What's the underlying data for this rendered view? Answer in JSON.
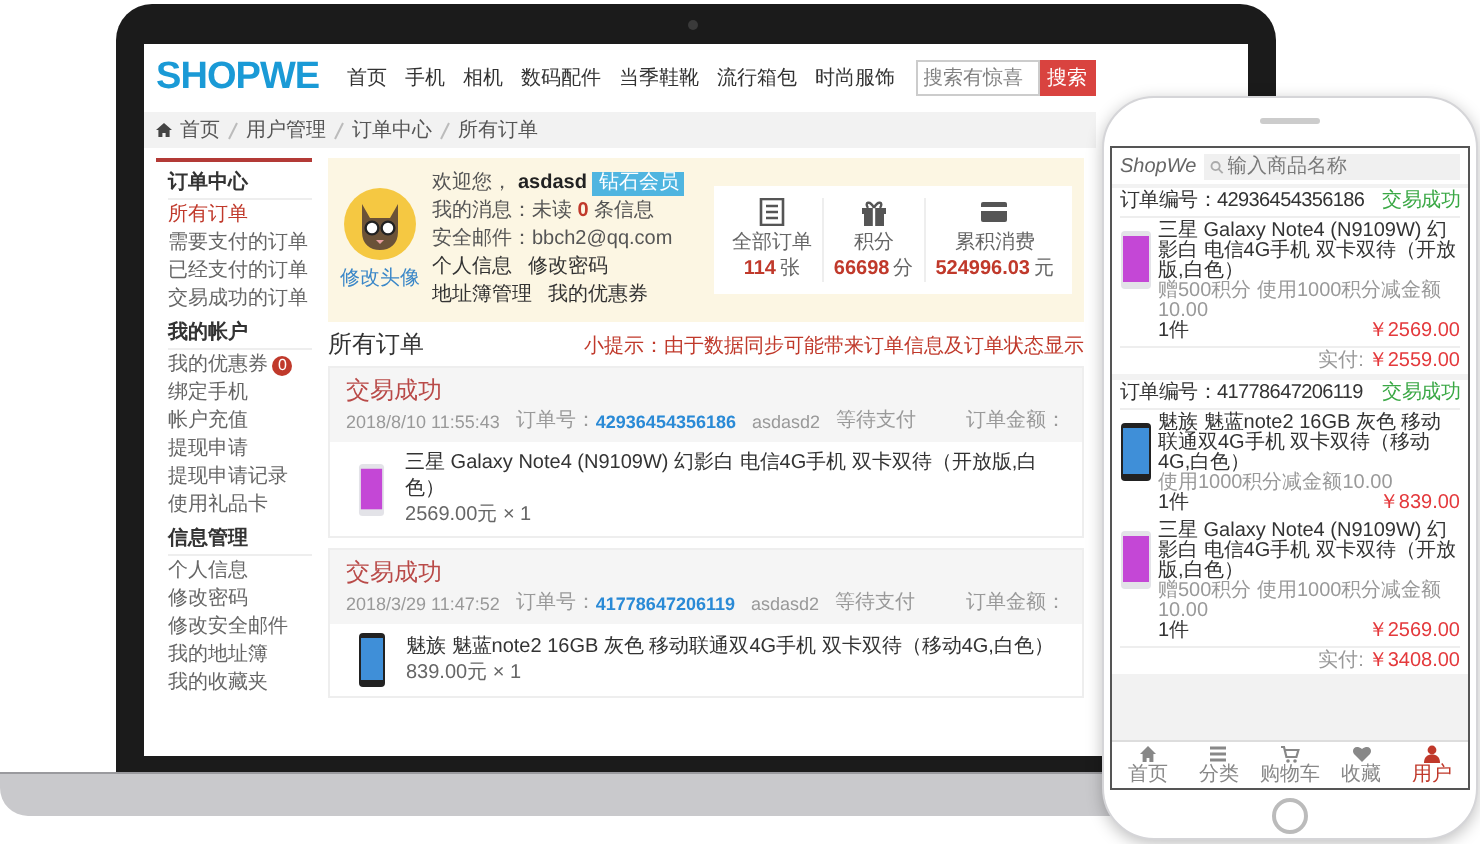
{
  "laptop": {
    "logo": "SHOPWE",
    "nav": [
      "首页",
      "手机",
      "相机",
      "数码配件",
      "当季鞋靴",
      "流行箱包",
      "时尚服饰"
    ],
    "search": {
      "placeholder": "搜索有惊喜"
    },
    "search_button": "搜索",
    "breadcrumb": [
      "首页",
      "用户管理",
      "订单中心",
      "所有订单"
    ],
    "sidebar": [
      {
        "title": "订单中心",
        "items": [
          {
            "label": "所有订单",
            "selected": true
          },
          {
            "label": "需要支付的订单",
            "selected": false
          },
          {
            "label": "已经支付的订单",
            "selected": false
          },
          {
            "label": "交易成功的订单",
            "selected": false
          }
        ]
      },
      {
        "title": "我的帐户",
        "items": [
          {
            "label": "我的优惠券",
            "selected": false,
            "badge": "0"
          },
          {
            "label": "绑定手机",
            "selected": false
          },
          {
            "label": "帐户充值",
            "selected": false
          },
          {
            "label": "提现申请",
            "selected": false
          },
          {
            "label": "提现申请记录",
            "selected": false
          },
          {
            "label": "使用礼品卡",
            "selected": false
          }
        ]
      },
      {
        "title": "信息管理",
        "items": [
          {
            "label": "个人信息",
            "selected": false
          },
          {
            "label": "修改密码",
            "selected": false
          },
          {
            "label": "修改安全邮件",
            "selected": false
          },
          {
            "label": "我的地址簿",
            "selected": false
          },
          {
            "label": "我的收藏夹",
            "selected": false
          }
        ]
      }
    ],
    "profile": {
      "avatar_link": "修改头像",
      "greeting": "欢迎您，",
      "username": "asdasd",
      "level_badge": "钻石会员",
      "messages": "我的消息：未读 **0** 条信息",
      "email": "安全邮件：bbch2@qq.com",
      "links": [
        "个人信息",
        "修改密码",
        "地址簿管理",
        "我的优惠券"
      ]
    },
    "stats": [
      {
        "label": "全部订单",
        "value": "114",
        "unit": "张"
      },
      {
        "label": "积分",
        "value": "66698",
        "unit": "分"
      },
      {
        "label": "累积消费",
        "value": "524996.03",
        "unit": "元"
      }
    ],
    "orders_title": "所有订单",
    "tip": "小提示：由于数据同步可能带来订单信息及订单状态显示",
    "orders": [
      {
        "status": "交易成功",
        "time": "2018/8/10 11:55:43",
        "number_label": "订单号：",
        "number": "42936454356186",
        "user": "asdasd2",
        "payment": "等待支付",
        "amount_label": "订单金额：",
        "items": [
          {
            "name": "三星 Galaxy Note4 (N9109W) 幻影白 电信4G手机 双卡双待（开放版,白色）",
            "price": "2569.00元 × 1"
          }
        ]
      },
      {
        "status": "交易成功",
        "time": "2018/3/29 11:47:52",
        "number_label": "订单号：",
        "number": "41778647206119",
        "user": "asdasd2",
        "payment": "等待支付",
        "amount_label": "订单金额：",
        "items": [
          {
            "name": "魅族 魅蓝note2 16GB 灰色 移动联通双4G手机 双卡双待（移动4G,白色）",
            "price": "839.00元 × 1"
          }
        ]
      }
    ]
  },
  "phone": {
    "logo": "ShopWe",
    "search": {
      "placeholder": "输入商品名称"
    },
    "orders": [
      {
        "number": "订单编号：42936454356186",
        "status": "交易成功",
        "items": [
          {
            "name": "三星 Galaxy Note4 (N9109W) 幻影白 电信4G手机 双卡双待（开放版,白色）",
            "promo": "赠500积分 使用1000积分减金额10.00",
            "qty": "1件",
            "price": "￥2569.00"
          }
        ],
        "total_label": "实付:",
        "total": "￥2559.00"
      },
      {
        "number": "订单编号：41778647206119",
        "status": "交易成功",
        "items": [
          {
            "name": "魅族 魅蓝note2 16GB 灰色 移动联通双4G手机 双卡双待（移动4G,白色）",
            "promo": "使用1000积分减金额10.00",
            "qty": "1件",
            "price": "￥839.00"
          },
          {
            "name": "三星 Galaxy Note4 (N9109W) 幻影白 电信4G手机 双卡双待（开放版,白色）",
            "promo": "赠500积分 使用1000积分减金额10.00",
            "qty": "1件",
            "price": "￥2569.00"
          }
        ],
        "total_label": "实付:",
        "total": "￥3408.00"
      }
    ],
    "tabs": [
      {
        "label": "首页",
        "selected": false
      },
      {
        "label": "分类",
        "selected": false
      },
      {
        "label": "购物车",
        "selected": false
      },
      {
        "label": "收藏",
        "selected": false
      },
      {
        "label": "用户",
        "selected": true
      }
    ]
  }
}
